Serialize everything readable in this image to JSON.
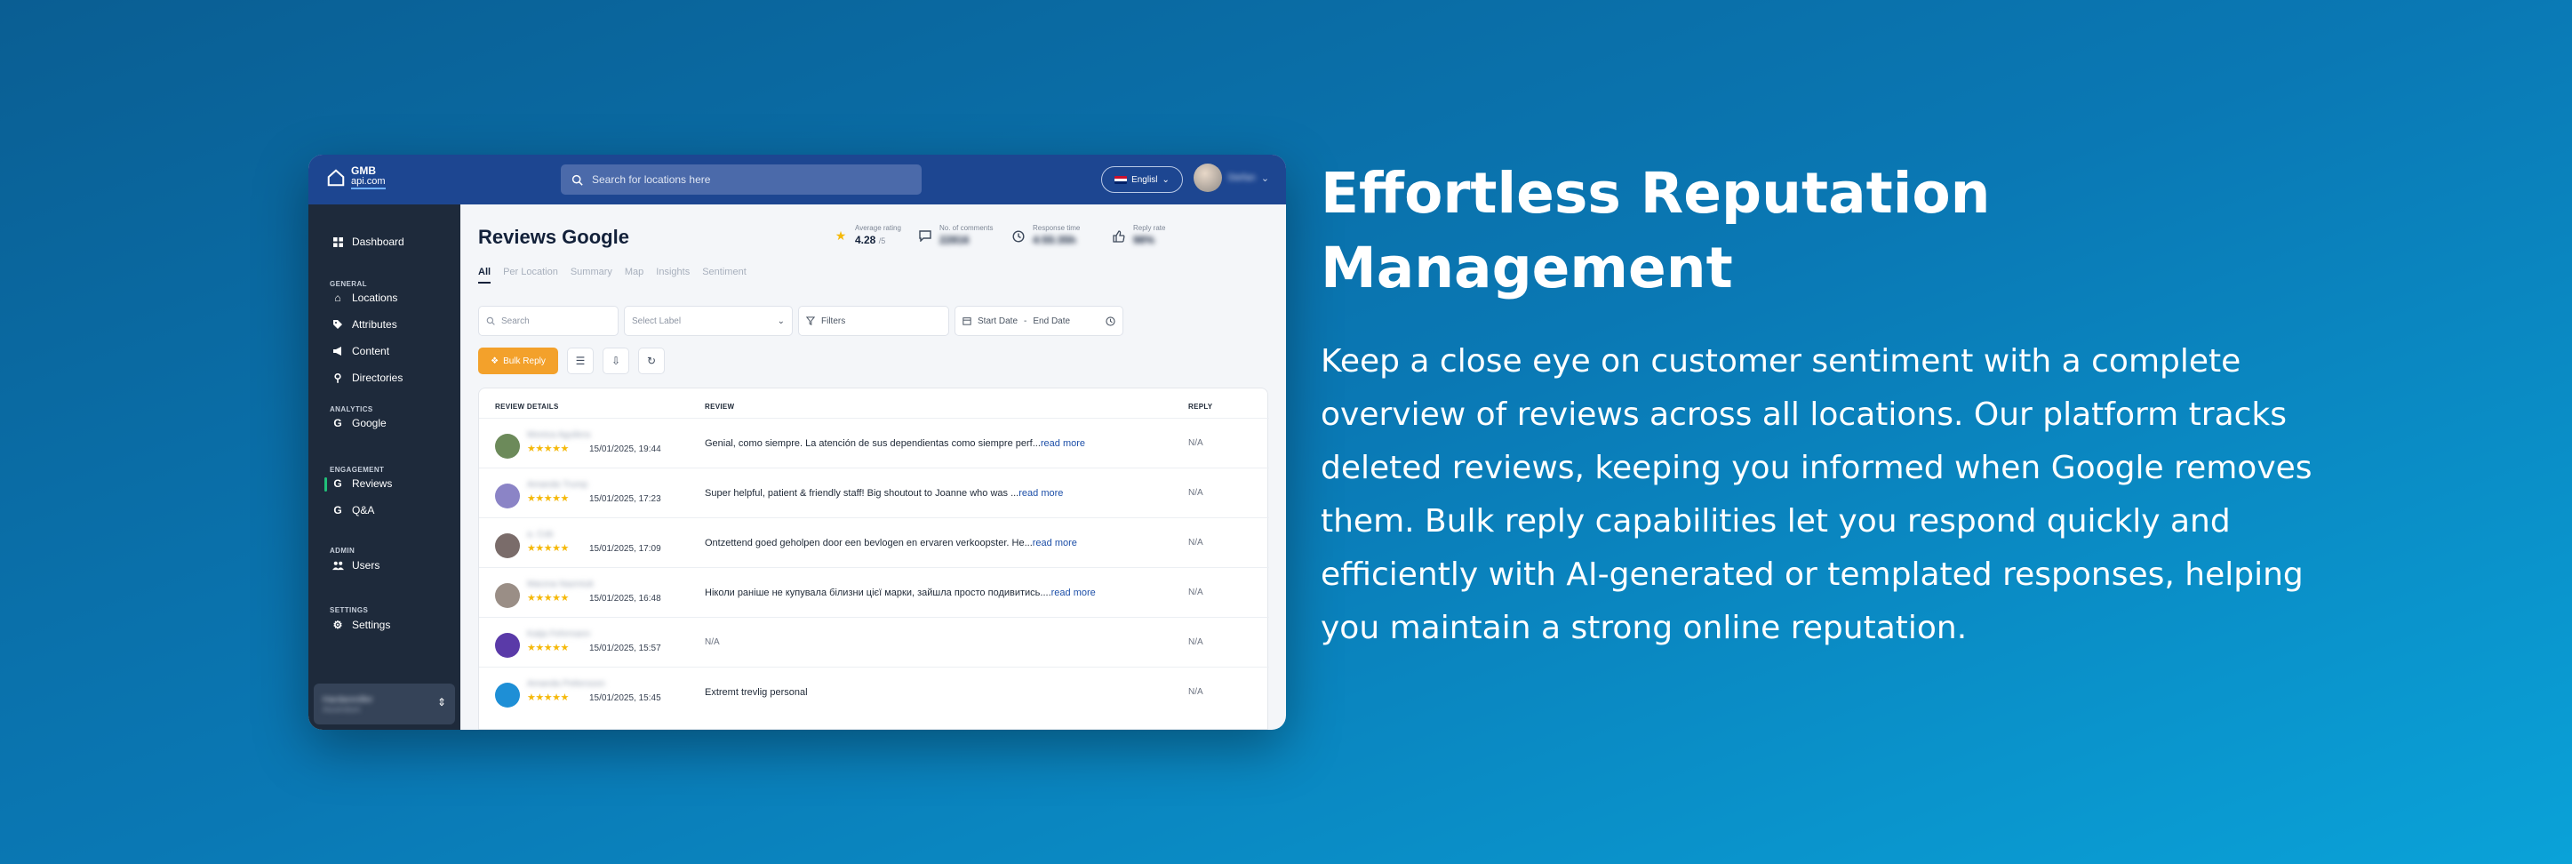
{
  "app": {
    "logo": {
      "line1": "GMB",
      "line2": "api.com"
    },
    "search": {
      "placeholder": "Search for locations here"
    },
    "language": "Englisl",
    "user_name": "Stefan"
  },
  "sidebar": {
    "dashboard": "Dashboard",
    "sections": {
      "general": "GENERAL",
      "analytics": "ANALYTICS",
      "engagement": "ENGAGEMENT",
      "admin": "ADMIN",
      "settings": "SETTINGS"
    },
    "items": {
      "locations": "Locations",
      "attributes": "Attributes",
      "content": "Content",
      "directories": "Directories",
      "google": "Google",
      "reviews": "Reviews",
      "qa": "Q&A",
      "users": "Users",
      "settings": "Settings"
    },
    "account": {
      "name": "Hardanmiller",
      "role": "Ascendum"
    }
  },
  "page": {
    "title": "Reviews Google",
    "stats": [
      {
        "icon": "star-icon",
        "label": "Average rating",
        "value": "4.28",
        "suffix": "/5"
      },
      {
        "icon": "comment-icon",
        "label": "No. of comments",
        "value": "22816"
      },
      {
        "icon": "clock-icon",
        "label": "Response time",
        "value": "4:55:35h"
      },
      {
        "icon": "thumbs-up-icon",
        "label": "Reply rate",
        "value": "98%"
      }
    ],
    "tabs": [
      "All",
      "Per Location",
      "Summary",
      "Map",
      "Insights",
      "Sentiment"
    ],
    "filters": {
      "search_placeholder": "Search",
      "label_placeholder": "Select Label",
      "filters": "Filters",
      "start_date": "Start Date",
      "date_sep": "-",
      "end_date": "End Date"
    },
    "bulk_reply": "Bulk Reply",
    "table": {
      "headers": {
        "details": "REVIEW DETAILS",
        "review": "REVIEW",
        "reply": "REPLY"
      },
      "rows": [
        {
          "name": "Monica Aguilera",
          "stars": "★★★★★",
          "date": "15/01/2025, 19:44",
          "review": "Genial, como siempre. La atención de sus dependientas como siempre perf...",
          "more": "read more",
          "reply": "N/A",
          "avatar_color": "#6c8a5a"
        },
        {
          "name": "Amanda Trump",
          "stars": "★★★★★",
          "date": "15/01/2025, 17:23",
          "review": "Super helpful, patient & friendly staff! Big shoutout to Joanne who was ...",
          "more": "read more",
          "reply": "N/A",
          "avatar_color": "#8b84c6"
        },
        {
          "name": "a. Cob",
          "stars": "★★★★★",
          "date": "15/01/2025, 17:09",
          "review": "Ontzettend goed geholpen door een bevlogen en ervaren verkoopster. He...",
          "more": "read more",
          "reply": "N/A",
          "avatar_color": "#7a6c6a"
        },
        {
          "name": "Marzna Nazmiuk",
          "stars": "★★★★★",
          "date": "15/01/2025, 16:48",
          "review": "Ніколи раніше не купувала білизни цієї марки, зайшла просто подивитись....",
          "more": "read more",
          "reply": "N/A",
          "avatar_color": "#9a8e86"
        },
        {
          "name": "Katja Fehrmann",
          "stars": "★★★★★",
          "date": "15/01/2025, 15:57",
          "review": "N/A",
          "more": "",
          "reply": "N/A",
          "avatar_color": "#5a3aa8"
        },
        {
          "name": "Amanda Pettersson",
          "stars": "★★★★★",
          "date": "15/01/2025, 15:45",
          "review": "Extremt trevlig personal",
          "more": "",
          "reply": "N/A",
          "avatar_color": "#1e8fd6"
        }
      ]
    }
  },
  "marketing": {
    "headline_line1": "Effortless Reputation",
    "headline_line2": "Management",
    "paragraph": "Keep a close eye on customer sentiment with a complete overview of reviews across all locations. Our platform tracks deleted reviews, keeping you informed when Google removes them. Bulk reply capabilities let you respond quickly and efficiently with AI-generated or templated responses, helping you maintain a strong online reputation."
  }
}
